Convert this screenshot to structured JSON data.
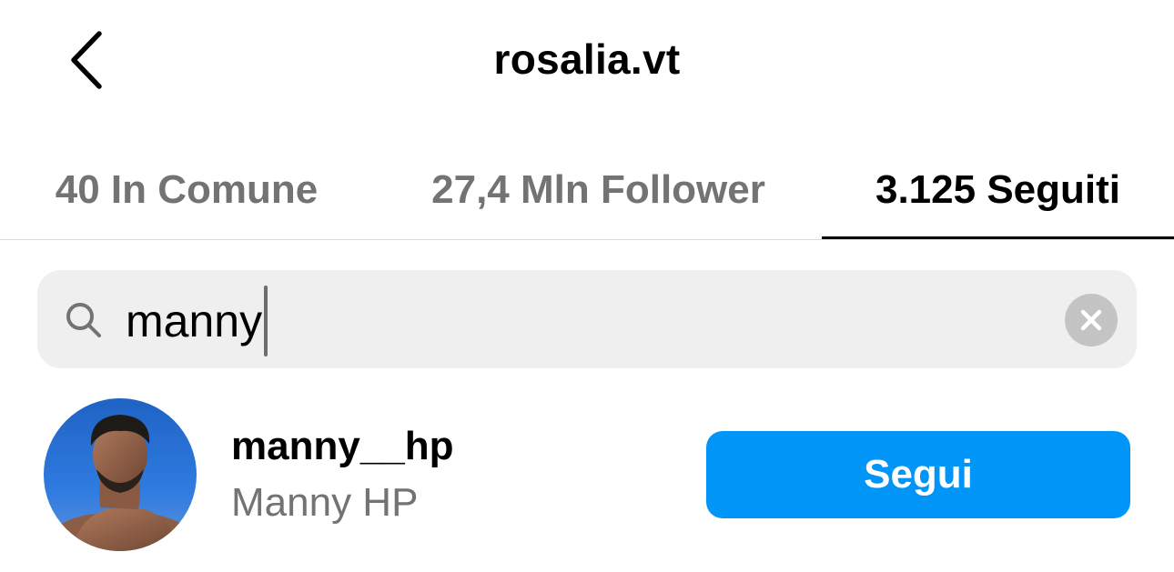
{
  "header": {
    "back_icon": "chevron-left-icon",
    "title": "rosalia.vt"
  },
  "tabs": [
    {
      "label": "40 In Comune",
      "active": false
    },
    {
      "label": "27,4 Mln Follower",
      "active": false
    },
    {
      "label": "3.125 Seguiti",
      "active": true
    }
  ],
  "search": {
    "icon": "search-icon",
    "value": "manny",
    "clear_icon": "clear-icon"
  },
  "results": [
    {
      "username": "manny__hp",
      "full_name": "Manny HP",
      "button_label": "Segui"
    }
  ],
  "colors": {
    "accent": "#0095f6",
    "secondary_text": "#737373",
    "search_bg": "#efefef"
  }
}
